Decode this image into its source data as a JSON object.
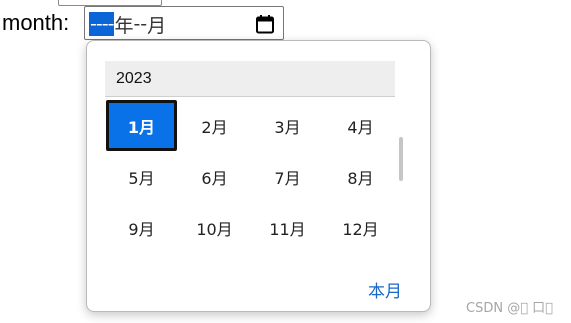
{
  "form": {
    "label": "month:",
    "input": {
      "year_placeholder": "----",
      "year_suffix": "年",
      "month_placeholder": "--",
      "month_suffix": "月"
    }
  },
  "picker": {
    "year": "2023",
    "months": [
      "1月",
      "2月",
      "3月",
      "4月",
      "5月",
      "6月",
      "7月",
      "8月",
      "9月",
      "10月",
      "11月",
      "12月"
    ],
    "selected_index": 0,
    "this_month_button": "本月"
  },
  "watermark": "CSDN @\u0000 口\u0000",
  "icons": {
    "calendar": "calendar-icon"
  },
  "colors": {
    "accent": "#0a72e8",
    "link": "#1a67c9"
  }
}
